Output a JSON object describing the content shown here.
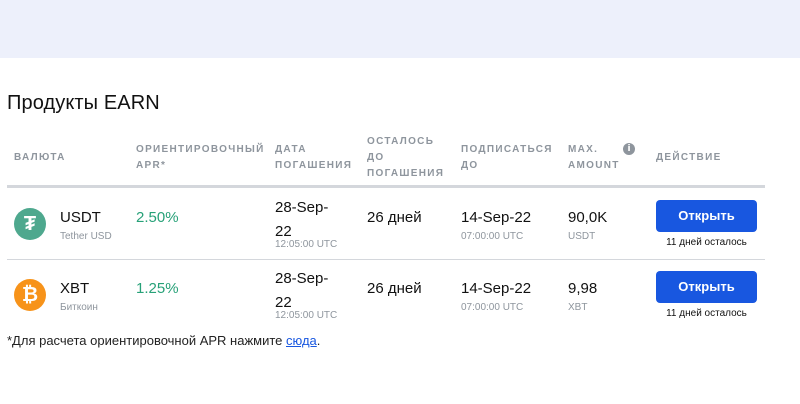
{
  "page": {
    "title": "Продукты EARN"
  },
  "columns": {
    "currency": "ВАЛЮТА",
    "apr": [
      "ОРИЕНТИРОВОЧНЫЙ",
      "APR*"
    ],
    "maturity": [
      "ДАТА",
      "ПОГАШЕНИЯ"
    ],
    "remaining": [
      "ОСТАЛОСЬ",
      "ДО",
      "ПОГАШЕНИЯ"
    ],
    "subscribe": [
      "ПОДПИСАТЬСЯ",
      "ДО"
    ],
    "max_amount": [
      "MAX.",
      "AMOUNT"
    ],
    "info_icon": "info-icon",
    "action": "ДЕЙСТВИЕ"
  },
  "rows": [
    {
      "icon": "tether-icon",
      "icon_color": "#4ea88e",
      "icon_glyph": "₮",
      "symbol": "USDT",
      "name": "Tether USD",
      "apr": "2.50%",
      "maturity_date": [
        "28-Sep-",
        "22"
      ],
      "maturity_time": "12:05:00 UTC",
      "days_left": "26 дней",
      "subscribe_date": "14-Sep-22",
      "subscribe_time": "07:00:00 UTC",
      "max_amount": "90,0K",
      "max_currency": "USDT",
      "button": "Открыть",
      "remaining_label": "11 дней осталось"
    },
    {
      "icon": "bitcoin-icon",
      "icon_color": "#f7931a",
      "icon_glyph": "₿",
      "symbol": "XBT",
      "name": "Биткоин",
      "apr": "1.25%",
      "maturity_date": [
        "28-Sep-",
        "22"
      ],
      "maturity_time": "12:05:00 UTC",
      "days_left": "26 дней",
      "subscribe_date": "14-Sep-22",
      "subscribe_time": "07:00:00 UTC",
      "max_amount": "9,98",
      "max_currency": "XBT",
      "button": "Открыть",
      "remaining_label": "11 дней осталось"
    }
  ],
  "footnote": {
    "text": "*Для расчета ориентировочной APR нажмите ",
    "link": "сюда",
    "end": "."
  },
  "colors": {
    "accent": "#1857e0",
    "positive": "#27a178",
    "header_bg": "#edf0fb"
  }
}
